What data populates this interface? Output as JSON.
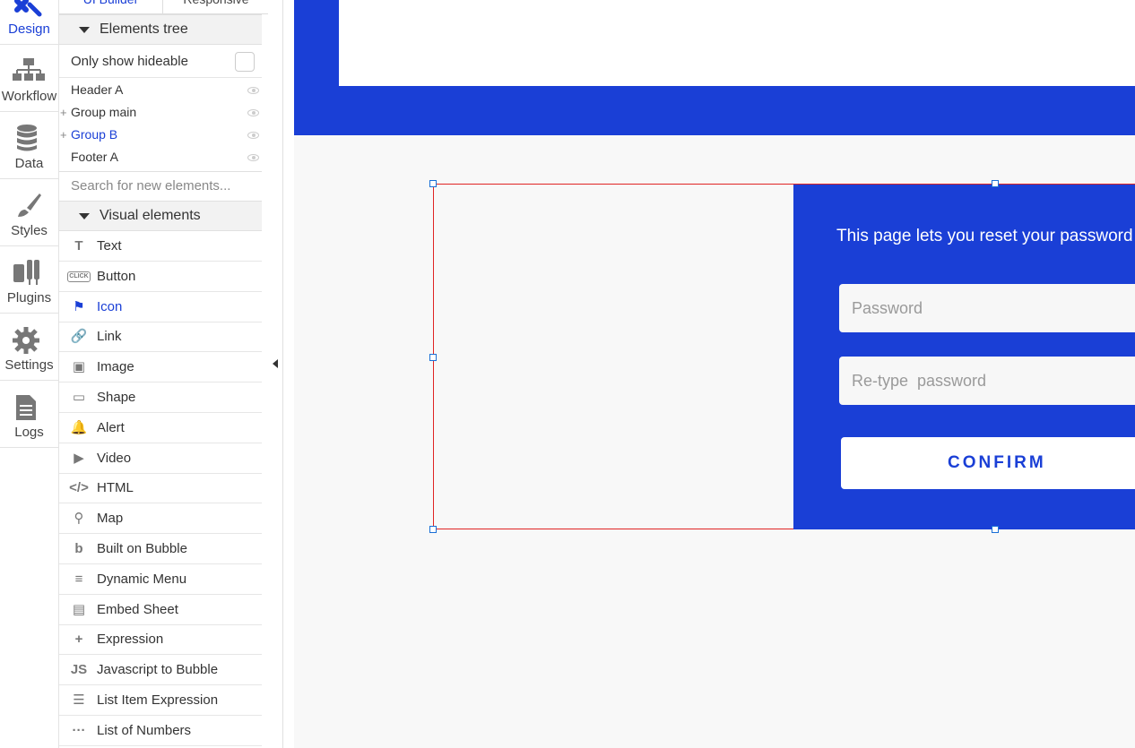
{
  "nav": {
    "items": [
      {
        "label": "Design",
        "icon": "design-icon"
      },
      {
        "label": "Workflow",
        "icon": "workflow-icon"
      },
      {
        "label": "Data",
        "icon": "database-icon"
      },
      {
        "label": "Styles",
        "icon": "brush-icon"
      },
      {
        "label": "Plugins",
        "icon": "plug-icon"
      },
      {
        "label": "Settings",
        "icon": "gear-icon"
      },
      {
        "label": "Logs",
        "icon": "document-icon"
      }
    ],
    "active_index": 0
  },
  "panel": {
    "tabs": [
      "UI Builder",
      "Responsive"
    ],
    "elements_tree_title": "Elements tree",
    "only_hideable_label": "Only show hideable",
    "tree": [
      {
        "label": "Header A",
        "expandable": false
      },
      {
        "label": "Group main",
        "expandable": true
      },
      {
        "label": "Group B",
        "expandable": true,
        "selected": true
      },
      {
        "label": "Footer A",
        "expandable": false
      }
    ],
    "search_placeholder": "Search for new elements...",
    "visual_elements_title": "Visual elements",
    "palette": [
      {
        "label": "Text",
        "icon": "text-icon",
        "glyph": "T"
      },
      {
        "label": "Button",
        "icon": "button-icon",
        "glyph": "CLICK"
      },
      {
        "label": "Icon",
        "icon": "flag-icon",
        "glyph": "⚑",
        "selected": true
      },
      {
        "label": "Link",
        "icon": "link-icon",
        "glyph": "🔗"
      },
      {
        "label": "Image",
        "icon": "image-icon",
        "glyph": "▣"
      },
      {
        "label": "Shape",
        "icon": "shape-icon",
        "glyph": "▭"
      },
      {
        "label": "Alert",
        "icon": "bell-icon",
        "glyph": "🔔"
      },
      {
        "label": "Video",
        "icon": "video-icon",
        "glyph": "▶"
      },
      {
        "label": "HTML",
        "icon": "code-icon",
        "glyph": "</>"
      },
      {
        "label": "Map",
        "icon": "map-pin-icon",
        "glyph": "⚲"
      },
      {
        "label": "Built on Bubble",
        "icon": "bubble-logo-icon",
        "glyph": "b"
      },
      {
        "label": "Dynamic Menu",
        "icon": "menu-icon",
        "glyph": "≡"
      },
      {
        "label": "Embed Sheet",
        "icon": "sheet-icon",
        "glyph": "▤"
      },
      {
        "label": "Expression",
        "icon": "plus-icon",
        "glyph": "+"
      },
      {
        "label": "Javascript to Bubble",
        "icon": "js-icon",
        "glyph": "JS"
      },
      {
        "label": "List Item Expression",
        "icon": "list-icon",
        "glyph": "☰"
      },
      {
        "label": "List of Numbers",
        "icon": "dots-icon",
        "glyph": "···"
      }
    ]
  },
  "canvas": {
    "info_text": "This page lets you reset your password",
    "password_placeholder": "Password",
    "retype_placeholder": "Re-type  password",
    "confirm_label": "CONFIRM"
  },
  "colors": {
    "accent": "#1a3fd6",
    "selection_border": "#e02424",
    "page_bg": "#f8f8f8"
  }
}
